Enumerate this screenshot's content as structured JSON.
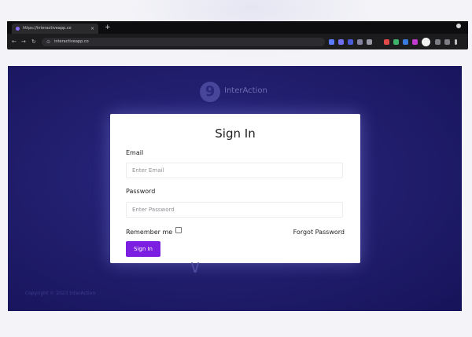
{
  "browser": {
    "tab_title": "https://interactiveapp.co",
    "url": "interactiveapp.co",
    "new_tab": "+",
    "close_tab": "×",
    "nav": {
      "back": "←",
      "forward": "→",
      "reload": "↻",
      "lock": "⊙"
    }
  },
  "brand": {
    "name": "InterAction",
    "mark": "9"
  },
  "signin": {
    "title": "Sign In",
    "email_label": "Email",
    "email_placeholder": "Enter Email",
    "password_label": "Password",
    "password_placeholder": "Enter Password",
    "remember_label": "Remember me",
    "forgot_label": "Forgot Password",
    "submit_label": "Sign In"
  },
  "footer": {
    "text": "Copyright © 2023 InterAction"
  },
  "colors": {
    "accent": "#7b1fe0",
    "background_deep": "#17135a",
    "card": "#ffffff"
  }
}
